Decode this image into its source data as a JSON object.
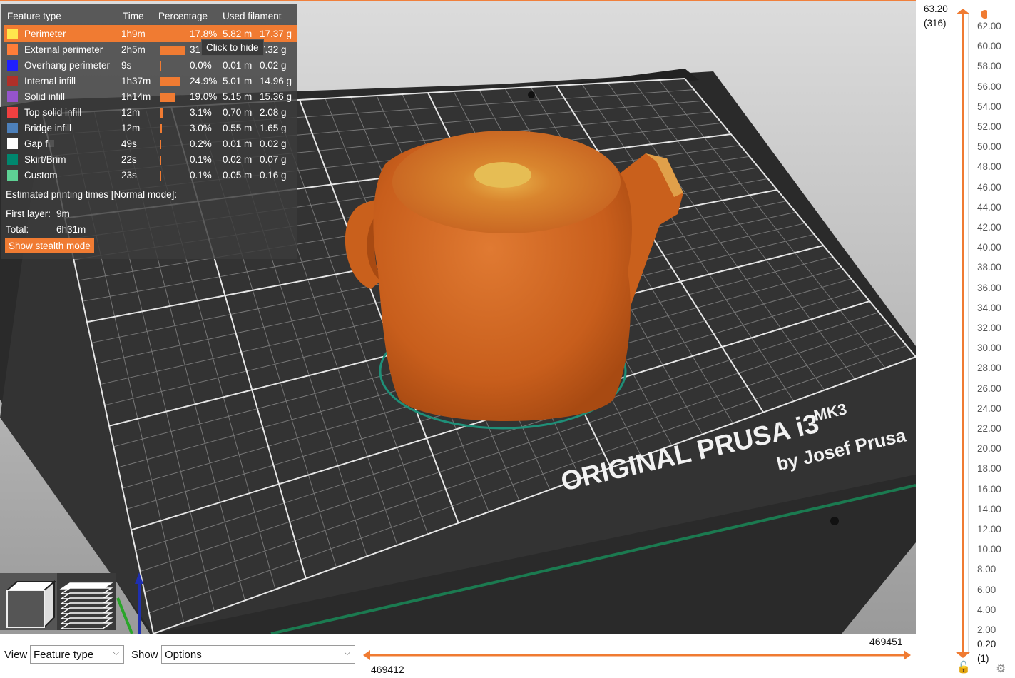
{
  "legend": {
    "headers": {
      "feature_type": "Feature type",
      "time": "Time",
      "percentage": "Percentage",
      "used_filament": "Used filament"
    },
    "rows": [
      {
        "name": "Perimeter",
        "time": "1h9m",
        "percent": "17.8%",
        "length": "5.82 m",
        "weight": "17.37 g",
        "color": "#ffe64d",
        "bar": 17.8
      },
      {
        "name": "External perimeter",
        "time": "2h5m",
        "percent": "31",
        "length": "",
        "weight": "7.32 g",
        "color": "#ff7d38",
        "bar": 31
      },
      {
        "name": "Overhang perimeter",
        "time": "9s",
        "percent": "0.0%",
        "length": "0.01 m",
        "weight": "0.02 g",
        "color": "#1f1fff",
        "bar": 0.0
      },
      {
        "name": "Internal infill",
        "time": "1h37m",
        "percent": "24.9%",
        "length": "5.01 m",
        "weight": "14.96 g",
        "color": "#b03029",
        "bar": 24.9
      },
      {
        "name": "Solid infill",
        "time": "1h14m",
        "percent": "19.0%",
        "length": "5.15 m",
        "weight": "15.36 g",
        "color": "#9654cc",
        "bar": 19.0
      },
      {
        "name": "Top solid infill",
        "time": "12m",
        "percent": "3.1%",
        "length": "0.70 m",
        "weight": "2.08 g",
        "color": "#f04040",
        "bar": 3.1
      },
      {
        "name": "Bridge infill",
        "time": "12m",
        "percent": "3.0%",
        "length": "0.55 m",
        "weight": "1.65 g",
        "color": "#4d80ba",
        "bar": 3.0
      },
      {
        "name": "Gap fill",
        "time": "49s",
        "percent": "0.2%",
        "length": "0.01 m",
        "weight": "0.02 g",
        "color": "#ffffff",
        "bar": 0.2
      },
      {
        "name": "Skirt/Brim",
        "time": "22s",
        "percent": "0.1%",
        "length": "0.02 m",
        "weight": "0.07 g",
        "color": "#00876e",
        "bar": 0.1
      },
      {
        "name": "Custom",
        "time": "23s",
        "percent": "0.1%",
        "length": "0.05 m",
        "weight": "0.16 g",
        "color": "#5ed194",
        "bar": 0.1
      }
    ],
    "estimated_title": "Estimated printing times [Normal mode]:",
    "first_layer_label": "First layer:",
    "first_layer_value": "9m",
    "total_label": "Total:",
    "total_value": "6h31m",
    "stealth_button": "Show stealth mode",
    "tooltip": "Click to hide"
  },
  "bed": {
    "line1": "ORIGINAL PRUSA i3",
    "line1_small": "MK3",
    "line2": "by Josef Prusa"
  },
  "bottom": {
    "view_label": "View",
    "view_value": "Feature type",
    "show_label": "Show",
    "show_value": "Options",
    "slider_top_value": "469451",
    "slider_bottom_value": "469412"
  },
  "vertical_slider": {
    "top_height": "63.20",
    "top_layer": "(316)",
    "bottom_height": "0.20",
    "bottom_layer": "(1)",
    "ticks": [
      "62.00",
      "60.00",
      "58.00",
      "56.00",
      "54.00",
      "52.00",
      "50.00",
      "48.00",
      "46.00",
      "44.00",
      "42.00",
      "40.00",
      "38.00",
      "36.00",
      "34.00",
      "32.00",
      "30.00",
      "28.00",
      "26.00",
      "24.00",
      "22.00",
      "20.00",
      "18.00",
      "16.00",
      "14.00",
      "12.00",
      "10.00",
      "8.00",
      "6.00",
      "4.00",
      "2.00"
    ]
  },
  "colors": {
    "accent": "#f07b32",
    "model": "#d0651f",
    "bed": "#2c2c2c"
  }
}
